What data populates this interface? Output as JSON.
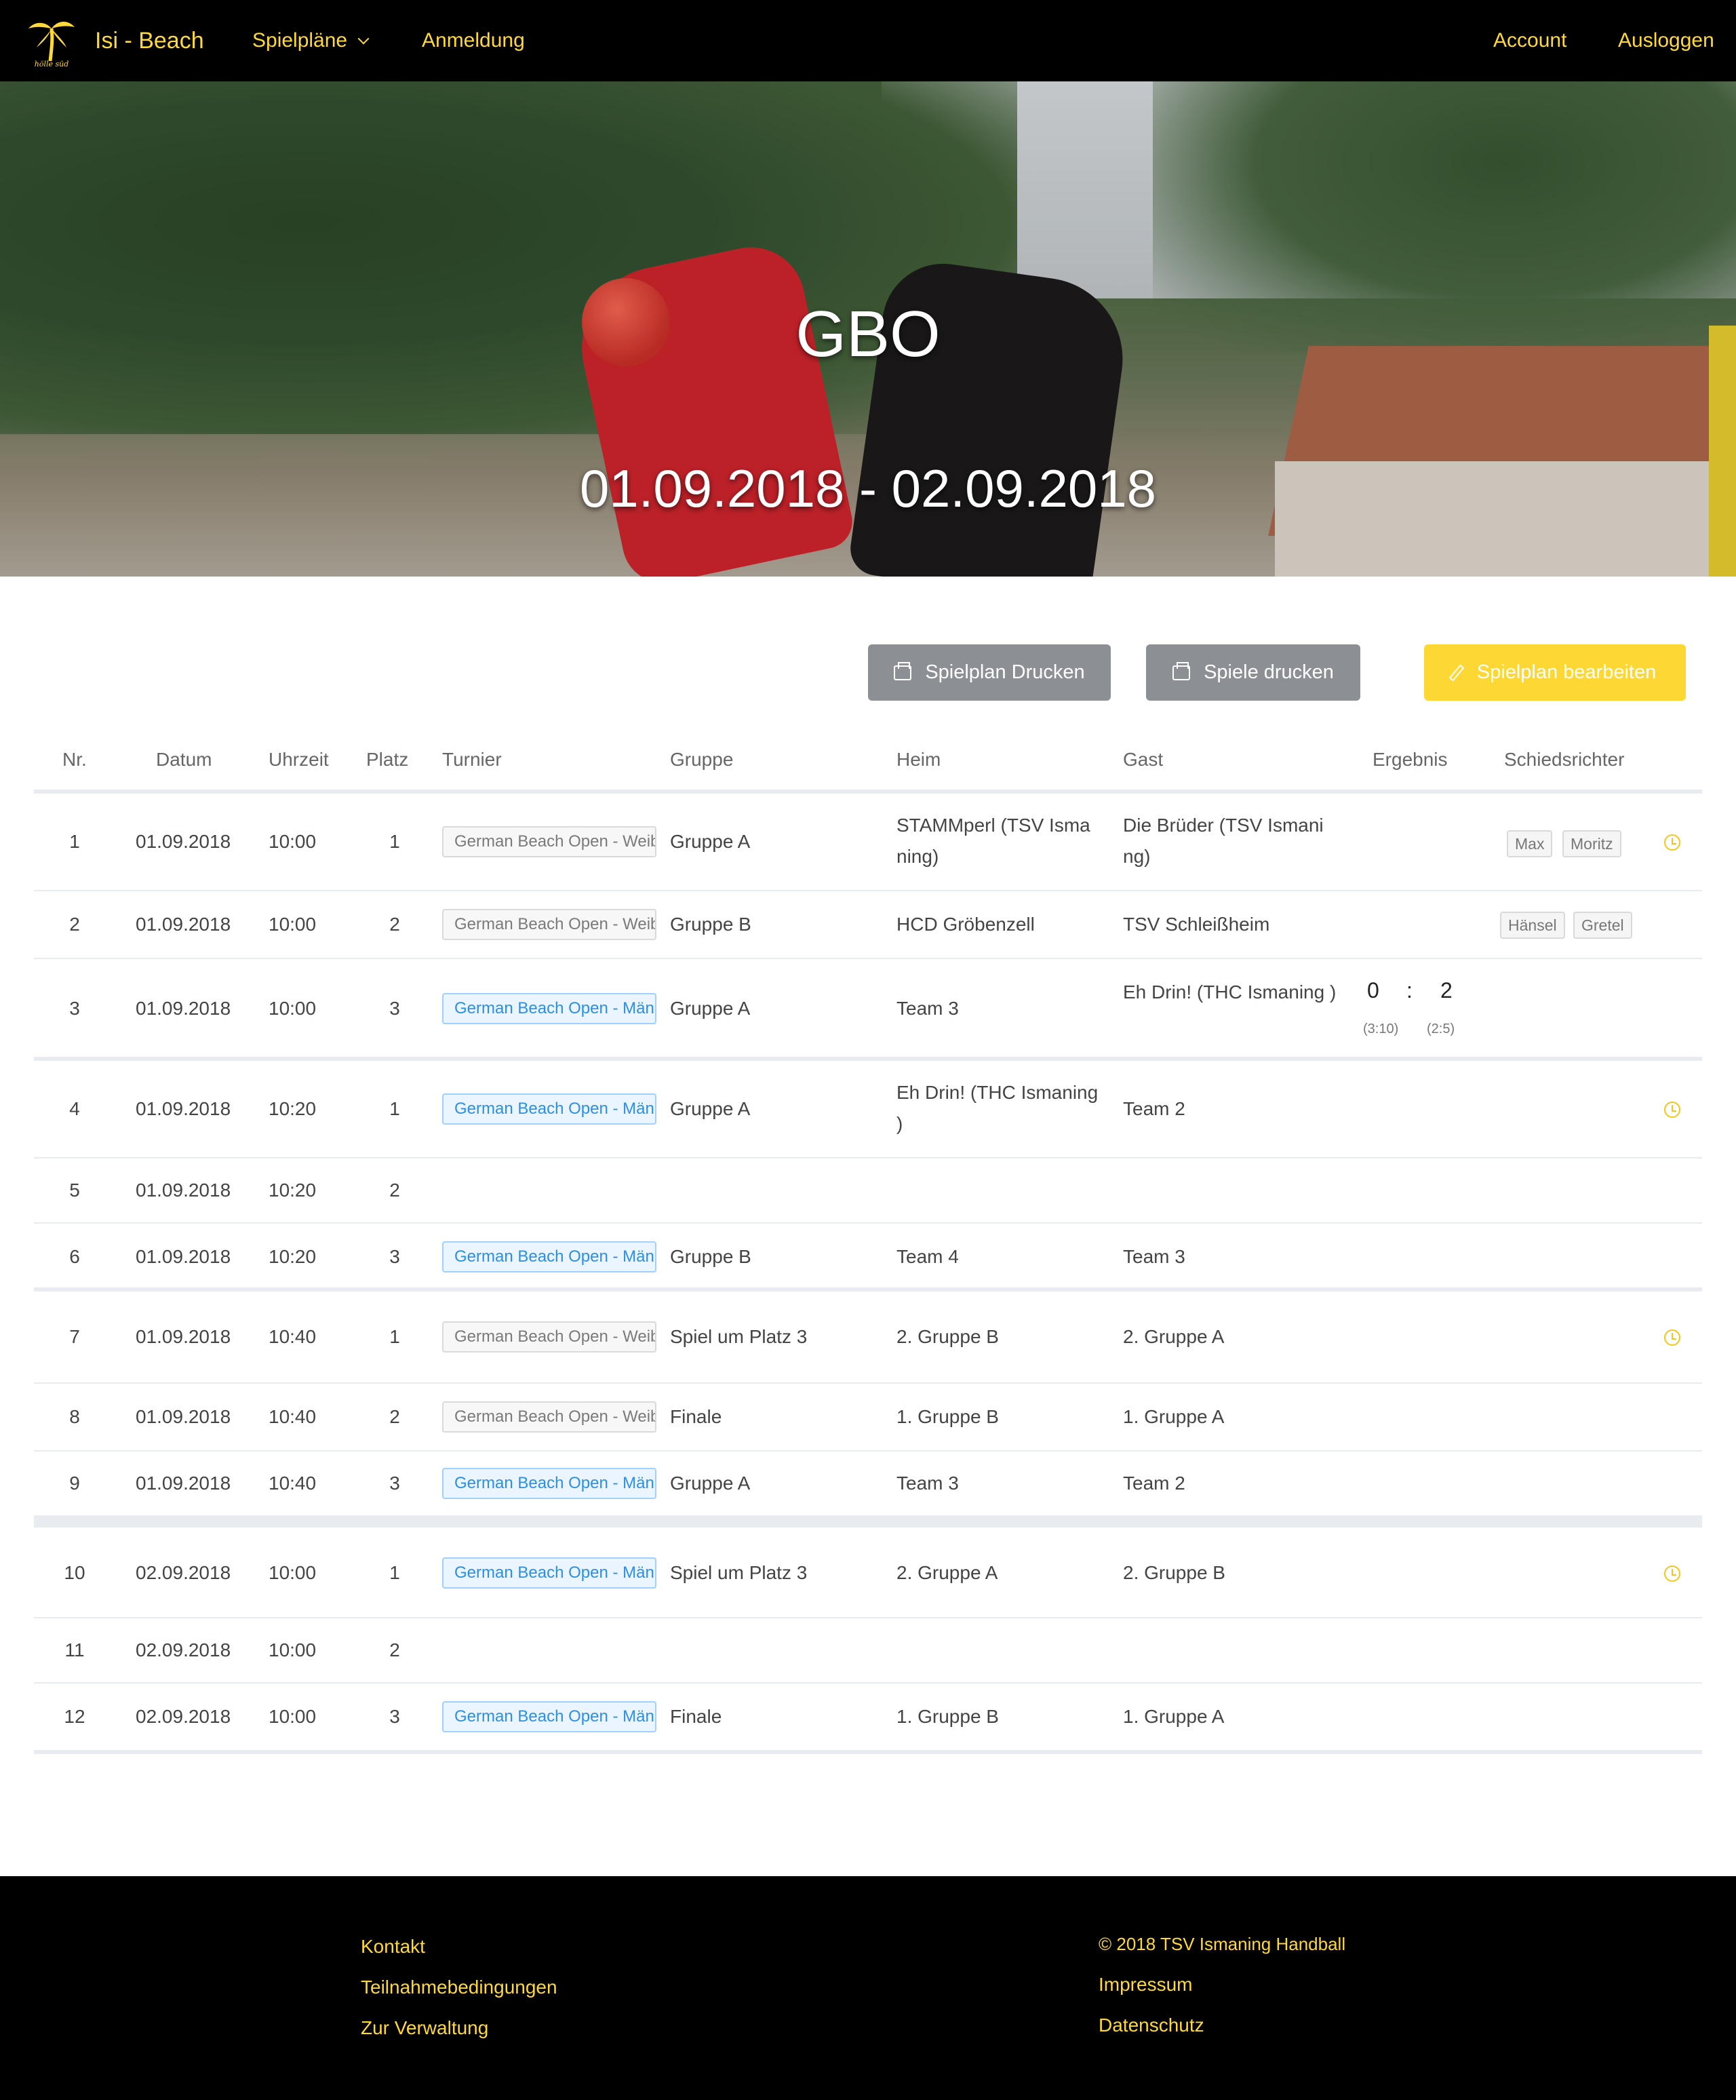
{
  "nav": {
    "brand": "Isi - Beach",
    "spielplaene": "Spielpläne",
    "anmeldung": "Anmeldung",
    "account": "Account",
    "ausloggen": "Ausloggen",
    "logo_text": "hölle süd"
  },
  "hero": {
    "title": "GBO",
    "dates": "01.09.2018 - 02.09.2018"
  },
  "actions": {
    "print_plan": "Spielplan Drucken",
    "print_games": "Spiele drucken",
    "edit_plan": "Spielplan bearbeiten"
  },
  "table": {
    "headers": {
      "nr": "Nr.",
      "datum": "Datum",
      "uhrzeit": "Uhrzeit",
      "platz": "Platz",
      "turnier": "Turnier",
      "gruppe": "Gruppe",
      "heim": "Heim",
      "gast": "Gast",
      "ergebnis": "Ergebnis",
      "schiedsrichter": "Schiedsrichter"
    },
    "rows": [
      {
        "nr": "1",
        "datum": "01.09.2018",
        "uhrzeit": "10:00",
        "platz": "1",
        "turnier": "German Beach Open - Weiblich",
        "gruppe": "Gruppe A",
        "heim": "STAMMperl (TSV Isma ning)",
        "gast": "Die Brüder (TSV Ismani ng)",
        "ref1": "Max",
        "ref2": "Moritz"
      },
      {
        "nr": "2",
        "datum": "01.09.2018",
        "uhrzeit": "10:00",
        "platz": "2",
        "turnier": "German Beach Open - Weiblich",
        "gruppe": "Gruppe B",
        "heim": "HCD Gröbenzell",
        "gast": "TSV Schleißheim",
        "ref1": "Hänsel",
        "ref2": "Gretel"
      },
      {
        "nr": "3",
        "datum": "01.09.2018",
        "uhrzeit": "10:00",
        "platz": "3",
        "turnier": "German Beach Open - Männlich",
        "gruppe": "Gruppe A",
        "heim": "Team 3",
        "gast": "Eh Drin! (THC Ismaning )",
        "score_home": "0",
        "score_sep": ":",
        "score_away": "2",
        "sub_home": "(3:10)",
        "sub_away": "(2:5)"
      },
      {
        "nr": "4",
        "datum": "01.09.2018",
        "uhrzeit": "10:20",
        "platz": "1",
        "turnier": "German Beach Open - Männlich",
        "gruppe": "Gruppe A",
        "heim": "Eh Drin! (THC Ismaning )",
        "gast": "Team 2"
      },
      {
        "nr": "5",
        "datum": "01.09.2018",
        "uhrzeit": "10:20",
        "platz": "2"
      },
      {
        "nr": "6",
        "datum": "01.09.2018",
        "uhrzeit": "10:20",
        "platz": "3",
        "turnier": "German Beach Open - Männlich",
        "gruppe": "Gruppe B",
        "heim": "Team 4",
        "gast": "Team 3"
      },
      {
        "nr": "7",
        "datum": "01.09.2018",
        "uhrzeit": "10:40",
        "platz": "1",
        "turnier": "German Beach Open - Weiblich",
        "gruppe": "Spiel um Platz 3",
        "heim": "2. Gruppe B",
        "gast": "2. Gruppe A"
      },
      {
        "nr": "8",
        "datum": "01.09.2018",
        "uhrzeit": "10:40",
        "platz": "2",
        "turnier": "German Beach Open - Weiblich",
        "gruppe": "Finale",
        "heim": "1. Gruppe B",
        "gast": "1. Gruppe A"
      },
      {
        "nr": "9",
        "datum": "01.09.2018",
        "uhrzeit": "10:40",
        "platz": "3",
        "turnier": "German Beach Open - Männlich",
        "gruppe": "Gruppe A",
        "heim": "Team 3",
        "gast": "Team 2"
      },
      {
        "nr": "10",
        "datum": "02.09.2018",
        "uhrzeit": "10:00",
        "platz": "1",
        "turnier": "German Beach Open - Männlich",
        "gruppe": "Spiel um Platz 3",
        "heim": "2. Gruppe A",
        "gast": "2. Gruppe B"
      },
      {
        "nr": "11",
        "datum": "02.09.2018",
        "uhrzeit": "10:00",
        "platz": "2"
      },
      {
        "nr": "12",
        "datum": "02.09.2018",
        "uhrzeit": "10:00",
        "platz": "3",
        "turnier": "German Beach Open - Männlich",
        "gruppe": "Finale",
        "heim": "1. Gruppe B",
        "gast": "1. Gruppe A"
      }
    ]
  },
  "footer": {
    "kontakt": "Kontakt",
    "teilnahme": "Teilnahmebedingungen",
    "verwaltung": "Zur Verwaltung",
    "copyright": "© 2018 TSV Ismaning Handball",
    "impressum": "Impressum",
    "datenschutz": "Datenschutz"
  },
  "colors": {
    "accent": "#ffd83a",
    "nav_bg": "#000000",
    "print_button": "#8c8f94",
    "edit_button": "#fdd835",
    "tag_blue": "#2b8fe6"
  }
}
